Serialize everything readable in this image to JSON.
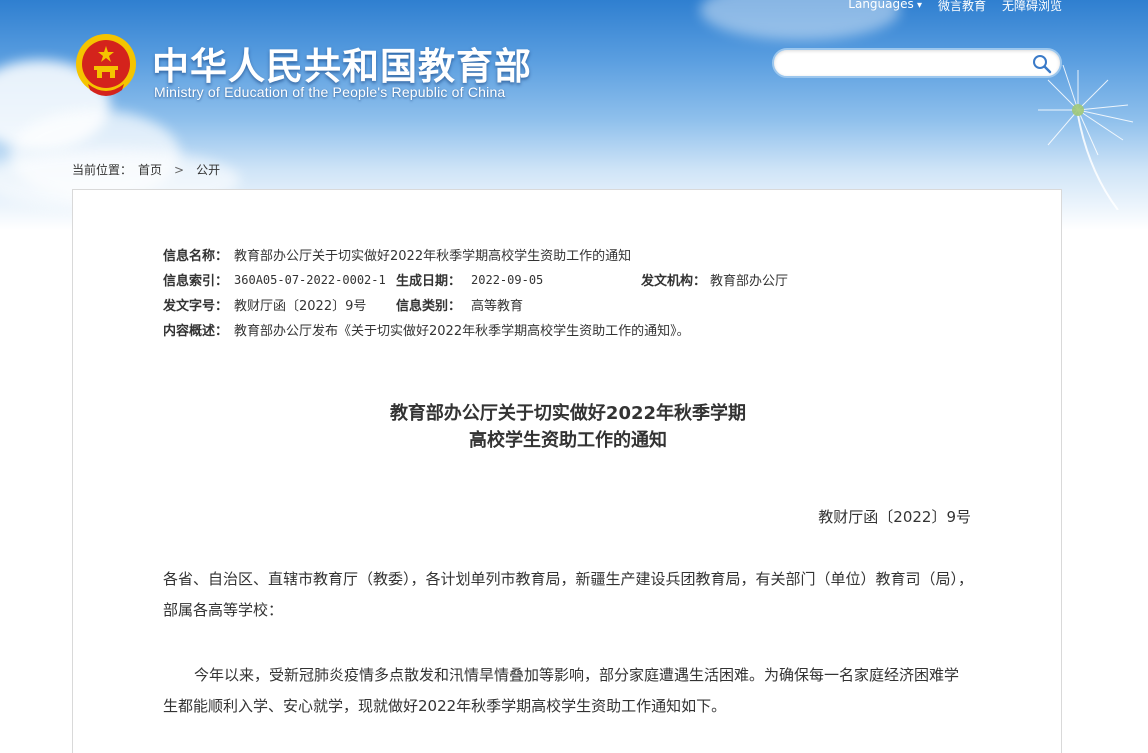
{
  "header": {
    "title_cn": "中华人民共和国教育部",
    "title_en": "Ministry of Education of the People's Republic of China",
    "top_links": [
      "Languages",
      "微言教育",
      "无障碍浏览"
    ],
    "search_placeholder": ""
  },
  "breadcrumb": {
    "prefix": "当前位置：",
    "items": [
      "首页",
      "公开"
    ]
  },
  "meta": {
    "name_label": "信息名称：",
    "name_value": "教育部办公厅关于切实做好2022年秋季学期高校学生资助工作的通知",
    "index_label": "信息索引：",
    "index_value": "360A05-07-2022-0002-1",
    "date_label": "生成日期：",
    "date_value": "2022-09-05",
    "org_label": "发文机构：",
    "org_value": "教育部办公厅",
    "docno_label": "发文字号：",
    "docno_value": "教财厅函〔2022〕9号",
    "category_label": "信息类别：",
    "category_value": "高等教育",
    "summary_label": "内容概述：",
    "summary_value": "教育部办公厅发布《关于切实做好2022年秋季学期高校学生资助工作的通知》。"
  },
  "document": {
    "title_line1": "教育部办公厅关于切实做好2022年秋季学期",
    "title_line2": "高校学生资助工作的通知",
    "doc_number": "教财厅函〔2022〕9号",
    "addressees": "各省、自治区、直辖市教育厅（教委），各计划单列市教育局，新疆生产建设兵团教育局，有关部门（单位）教育司（局），部属各高等学校：",
    "paragraph1": "今年以来，受新冠肺炎疫情多点散发和汛情旱情叠加等影响，部分家庭遭遇生活困难。为确保每一名家庭经济困难学生都能顺利入学、安心就学，现就做好2022年秋季学期高校学生资助工作通知如下。"
  },
  "icons": {
    "emblem": "national-emblem-icon",
    "search": "search-icon",
    "chevron": "chevron-down-icon"
  },
  "colors": {
    "header_blue": "#2f7fd0",
    "emblem_red": "#d4231c",
    "emblem_gold": "#f5c400"
  }
}
